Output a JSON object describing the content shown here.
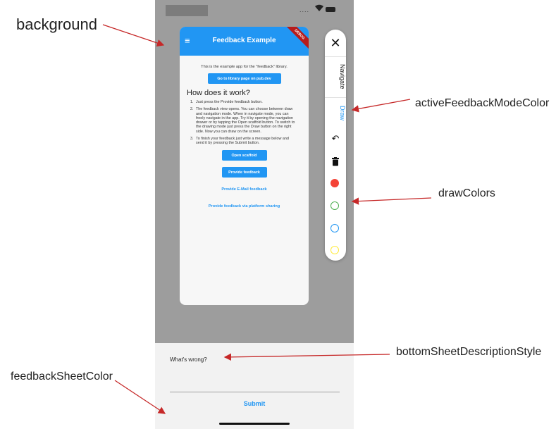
{
  "annotations": {
    "background": "background",
    "feedbackSheetColor": "feedbackSheetColor",
    "activeFeedbackModeColor": "activeFeedbackModeColor",
    "drawColors": "drawColors",
    "bottomSheetDescriptionStyle": "bottomSheetDescriptionStyle"
  },
  "status_bar": {
    "dots": "....",
    "wifi_icon": "wifi-icon",
    "battery_icon": "battery-icon"
  },
  "app": {
    "title": "Feedback Example",
    "debug_banner": "DEBUG",
    "intro": "This is the example app for the \"feedback\" library.",
    "library_button": "Go to library page on pub.dev",
    "how_title": "How does it work?",
    "steps": [
      {
        "num": "1.",
        "text": "Just press the Provide feedback button."
      },
      {
        "num": "2.",
        "text": "The feedback view opens. You can choose between draw and navigation mode. When in navigate mode, you can freely navigate in the app. Try it by opening the navigation drawer or by tapping the Open scaffold button. To switch to the drawing mode just press the Draw button on the right side. Now you can draw on the screen."
      },
      {
        "num": "3.",
        "text": "To finish your feedback just write a message below and send it by pressing the Submit button."
      }
    ],
    "open_scaffold_button": "Open scaffold",
    "provide_feedback_button": "Provide feedback",
    "email_link": "Provide E-Mail feedback",
    "share_link": "Provide feedback via platform sharing"
  },
  "side_panel": {
    "close": "✕",
    "navigate": "Navigate",
    "draw": "Draw",
    "undo": "↶",
    "colors": {
      "active": "#2196f3",
      "draw": [
        "#f44336",
        "#4caf50",
        "#2196f3",
        "#ffeb3b"
      ]
    }
  },
  "sheet": {
    "label": "What's wrong?",
    "submit": "Submit",
    "background": "#f2f2f2"
  }
}
